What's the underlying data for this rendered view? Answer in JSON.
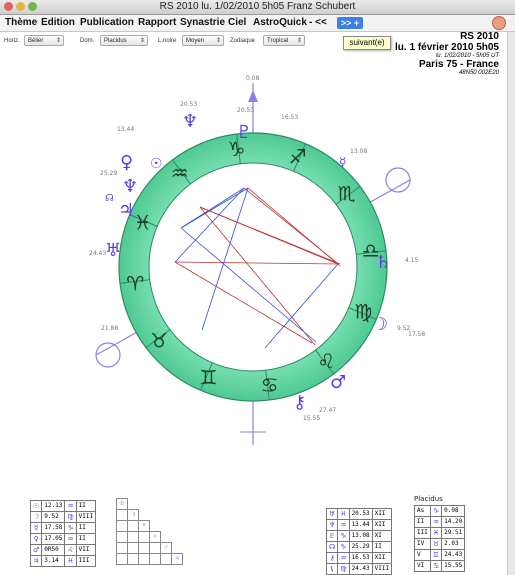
{
  "window": {
    "title": "RS 2010 lu. 1/02/2010 5h05 Franz Schubert"
  },
  "menu": [
    "Thème",
    "Edition",
    "Publication",
    "Rapport",
    "Synastrie",
    "Ciel",
    "AstroQuick",
    "- <<"
  ],
  "nav": {
    "next_label": ">> +",
    "tooltip": "suivant(e)"
  },
  "toolbar": {
    "horiz_label": "Horiz.",
    "horiz_value": "Bélier",
    "dom_label": "Dom.",
    "dom_value": "Placidus",
    "lnoire_label": "L.noire",
    "lnoire_value": "Moyen",
    "zodiaque_label": "Zodiaque",
    "zodiaque_value": "Tropical"
  },
  "info": {
    "chart_name": "RS 2010",
    "date_line": "lu. 1 février 2010 5h05",
    "ut_line": "lu. 1/02/2010 - 5h05 UT",
    "place": "Paris 75 - France",
    "coords": "48N50 002E20"
  },
  "chart": {
    "zodiac_glyphs": [
      "♈",
      "♉",
      "♊",
      "♋",
      "♌",
      "♍",
      "♎",
      "♏",
      "♐",
      "♑",
      "♒",
      "♓"
    ],
    "degree_labels": [
      "0.08",
      "16.53",
      "20.53",
      "13.44",
      "25.29",
      "13.08",
      "4.15",
      "9.52",
      "20.53",
      "27.47",
      "21.88",
      "24.43",
      "15.55",
      "17.58"
    ],
    "planets": {
      "jupiter": "♃",
      "neptune": "♆",
      "uranus": "♅",
      "pluto": "♇",
      "venus": "♀",
      "saturn": "♄",
      "moon": "☽",
      "mars": "♂",
      "mercury": "☿",
      "sun": "☉",
      "node": "☊",
      "chiron": "⚷"
    },
    "colors": {
      "ring": "#5dd6a0",
      "ring_dark": "#3aa878",
      "glyph": "#5b3ee0",
      "axis": "#7a6ad8"
    }
  },
  "table_left": [
    {
      "g": "☉",
      "v": "12.13",
      "s": "♒",
      "h": "II"
    },
    {
      "g": "☽",
      "v": "9.52",
      "s": "♍",
      "h": "VIII"
    },
    {
      "g": "☿",
      "v": "17.58",
      "s": "♑",
      "h": "II"
    },
    {
      "g": "♀",
      "v": "17.05",
      "s": "♒",
      "h": "II"
    },
    {
      "g": "♂",
      "v": "0R50",
      "s": "♌",
      "h": "VII"
    },
    {
      "g": "♃",
      "v": "3.14",
      "s": "♓",
      "h": "III"
    }
  ],
  "table_right": [
    {
      "g": "♅",
      "s": "♓",
      "v": "20.53",
      "h": "XII"
    },
    {
      "g": "♆",
      "s": "♒",
      "v": "13.44",
      "h": "XII"
    },
    {
      "g": "♇",
      "s": "♑",
      "v": "13.08",
      "h": "XI"
    },
    {
      "g": "☊",
      "s": "♑",
      "v": "25.29",
      "h": "II"
    },
    {
      "g": "⚷",
      "s": "♒",
      "v": "16.53",
      "h": "XII"
    },
    {
      "g": "⚸",
      "s": "♍",
      "v": "24.43",
      "h": "VIII"
    }
  ],
  "placidus": {
    "title": "Placidus",
    "rows": [
      {
        "h": "As",
        "s": "♑",
        "v": "0.08"
      },
      {
        "h": "II",
        "s": "♒",
        "v": "14.20"
      },
      {
        "h": "III",
        "s": "♓",
        "v": "29.51"
      },
      {
        "h": "IV",
        "s": "♉",
        "v": "2.03"
      },
      {
        "h": "V",
        "s": "♊",
        "v": "24.43"
      },
      {
        "h": "VI",
        "s": "♋",
        "v": "15.55"
      }
    ]
  }
}
